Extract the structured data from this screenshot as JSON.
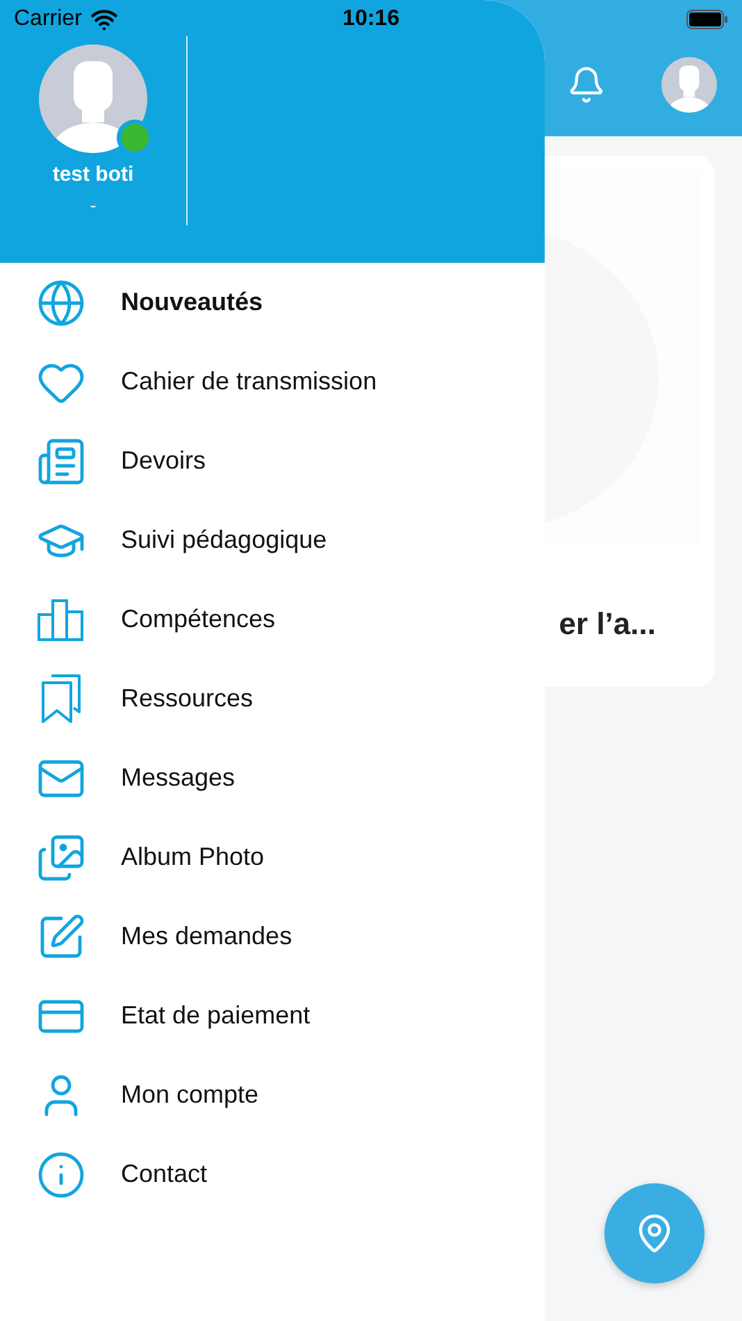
{
  "status_bar": {
    "carrier": "Carrier",
    "time": "10:16"
  },
  "drawer": {
    "user": {
      "name": "test boti",
      "subtitle": "-",
      "online": true
    },
    "items": [
      {
        "kind": "globe",
        "label": "Nouveautés",
        "selected": true
      },
      {
        "kind": "heart",
        "label": "Cahier de transmission",
        "selected": false
      },
      {
        "kind": "newspaper",
        "label": "Devoirs",
        "selected": false
      },
      {
        "kind": "cap",
        "label": "Suivi pédagogique",
        "selected": false
      },
      {
        "kind": "bars",
        "label": "Compétences",
        "selected": false
      },
      {
        "kind": "bookmarks",
        "label": "Ressources",
        "selected": false
      },
      {
        "kind": "mail",
        "label": "Messages",
        "selected": false
      },
      {
        "kind": "images",
        "label": "Album Photo",
        "selected": false
      },
      {
        "kind": "pen",
        "label": "Mes demandes",
        "selected": false
      },
      {
        "kind": "card",
        "label": "Etat de paiement",
        "selected": false
      },
      {
        "kind": "user",
        "label": "Mon compte",
        "selected": false
      },
      {
        "kind": "info",
        "label": "Contact",
        "selected": false
      }
    ]
  },
  "background": {
    "card_title": "er l’a..."
  }
}
